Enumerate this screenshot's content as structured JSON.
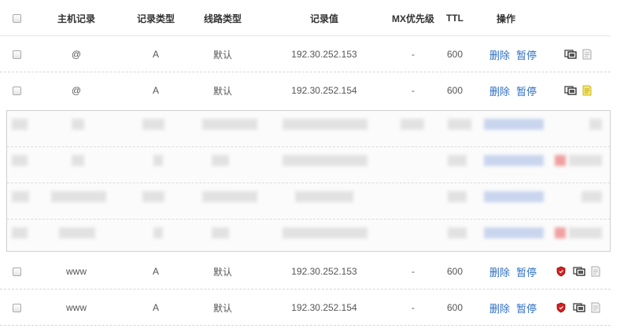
{
  "header": {
    "host": "主机记录",
    "type": "记录类型",
    "line": "线路类型",
    "value": "记录值",
    "mx": "MX优先级",
    "ttl": "TTL",
    "ops": "操作"
  },
  "rows_top": [
    {
      "host": "@",
      "type": "A",
      "line": "默认",
      "value": "192.30.252.153",
      "mx": "-",
      "ttl": "600",
      "delete": "删除",
      "pause": "暂停",
      "icons": [
        "monitor-icon",
        "note-icon"
      ]
    },
    {
      "host": "@",
      "type": "A",
      "line": "默认",
      "value": "192.30.252.154",
      "mx": "-",
      "ttl": "600",
      "delete": "删除",
      "pause": "暂停",
      "icons": [
        "monitor-icon",
        "note-yellow-icon"
      ]
    }
  ],
  "rows_bottom": [
    {
      "host": "www",
      "type": "A",
      "line": "默认",
      "value": "192.30.252.153",
      "mx": "-",
      "ttl": "600",
      "delete": "删除",
      "pause": "暂停",
      "icons": [
        "shield-icon",
        "monitor-icon",
        "note-icon"
      ]
    },
    {
      "host": "www",
      "type": "A",
      "line": "默认",
      "value": "192.30.252.154",
      "mx": "-",
      "ttl": "600",
      "delete": "删除",
      "pause": "暂停",
      "icons": [
        "shield-icon",
        "monitor-icon",
        "note-icon"
      ]
    }
  ],
  "colors": {
    "link": "#2f6fc4",
    "shield": "#d42020",
    "note_yellow": "#e8d84a"
  }
}
